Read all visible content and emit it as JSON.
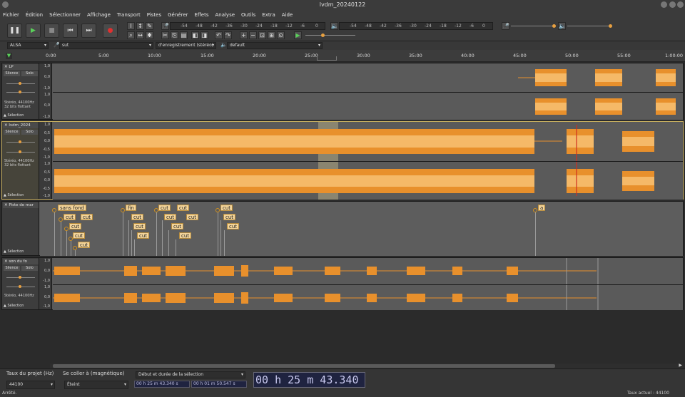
{
  "window": {
    "title": "lvdm_20240122"
  },
  "menu": [
    "Fichier",
    "Édition",
    "Sélectionner",
    "Affichage",
    "Transport",
    "Pistes",
    "Générer",
    "Effets",
    "Analyse",
    "Outils",
    "Extra",
    "Aide"
  ],
  "transport": {
    "pause": "pause-icon",
    "play": "play-icon",
    "stop": "stop-icon",
    "skip_start": "skip-start-icon",
    "skip_end": "skip-end-icon",
    "record": "record-icon"
  },
  "meters": {
    "record_scale": [
      "-54",
      "-48",
      "-42",
      "-36",
      "-30",
      "-24",
      "-18",
      "-12",
      "-6",
      "0"
    ],
    "play_scale": [
      "-54",
      "-48",
      "-42",
      "-36",
      "-30",
      "-24",
      "-18",
      "-12",
      "-6",
      "0"
    ],
    "lr": [
      "G",
      "D"
    ]
  },
  "devices": {
    "host": "ALSA",
    "input": "sut",
    "channels": "d'enregistrement (stéréo)",
    "output": "default"
  },
  "ruler": {
    "ticks": [
      "0:00",
      "5:00",
      "10:00",
      "15:00",
      "20:00",
      "25:00",
      "30:00",
      "35:00",
      "40:00",
      "45:00",
      "50:00",
      "55:00",
      "1:00:00"
    ]
  },
  "tracks": [
    {
      "name": "LP",
      "mute": "Silence",
      "solo": "Solo",
      "info": "Stéréo, 44100Hz\n32 bits flottant",
      "select": "Sélection",
      "scale": [
        "1,0",
        "0,0",
        "-1,0",
        "1,0",
        "0,0",
        "-1,0"
      ]
    },
    {
      "name": "lvdm_2024",
      "mute": "Silence",
      "solo": "Solo",
      "info": "Stéréo, 44100Hz\n32 bits flottant",
      "select": "Sélection",
      "scale": [
        "1,0",
        "0,5",
        "0,0",
        "-0,5",
        "-1,0",
        "1,0",
        "0,5",
        "0,0",
        "-0,5",
        "-1,0"
      ]
    },
    {
      "name": "Piste de mar",
      "select": "Sélection"
    },
    {
      "name": "son du fo",
      "mute": "Silence",
      "solo": "Solo",
      "info": "Stéréo, 44100Hz",
      "select": "Sélection",
      "scale": [
        "1,0",
        "0,0",
        "-1,0",
        "1,0",
        "0,0",
        "-1,0"
      ]
    }
  ],
  "labels": [
    "sans fond",
    "cut",
    "cut",
    "cut",
    "cut",
    "cut",
    "fin",
    "cut",
    "cut",
    "cut",
    "cut",
    "cut",
    "cut",
    "cut",
    "cut",
    "cut",
    "cut",
    "cut",
    "cut",
    "a"
  ],
  "selection_toolbar": {
    "rate_label": "Taux du projet (Hz)",
    "snap_label": "Se coller à (magnétique)",
    "range_mode": "Début et durée de la sélection",
    "rate_value": "44100",
    "snap_value": "Éteint",
    "start": "00 h 25 m 43.340 s",
    "length": "00 h 01 m 50.547 s",
    "big_time": "00 h 25 m 43.340 s"
  },
  "status": {
    "left": "Arrêté.",
    "right": "Taux actuel : 44100"
  }
}
